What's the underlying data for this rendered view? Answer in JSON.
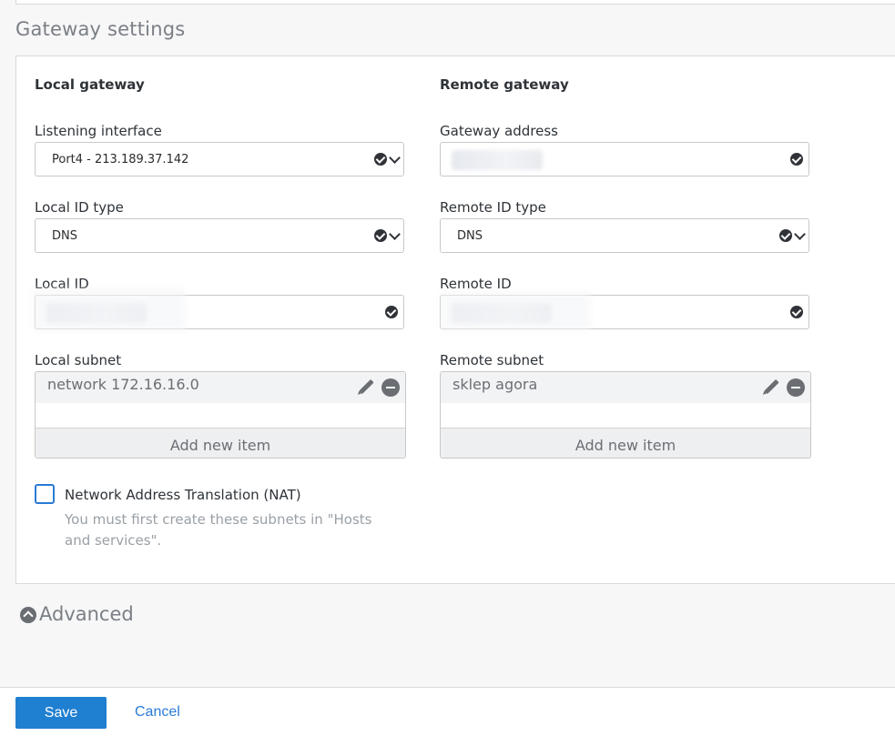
{
  "section": {
    "title": "Gateway settings"
  },
  "local": {
    "heading": "Local gateway",
    "listening_interface": {
      "label": "Listening interface",
      "value": "Port4 - 213.189.37.142"
    },
    "id_type": {
      "label": "Local ID type",
      "value": "DNS"
    },
    "id": {
      "label": "Local ID",
      "value": ""
    },
    "subnet": {
      "label": "Local subnet",
      "items": [
        "network 172.16.16.0"
      ],
      "add_label": "Add new item"
    }
  },
  "remote": {
    "heading": "Remote gateway",
    "gateway_address": {
      "label": "Gateway address",
      "value": ""
    },
    "id_type": {
      "label": "Remote ID type",
      "value": "DNS"
    },
    "id": {
      "label": "Remote ID",
      "value": ""
    },
    "subnet": {
      "label": "Remote subnet",
      "items": [
        "sklep agora"
      ],
      "add_label": "Add new item"
    }
  },
  "nat": {
    "label": "Network Address Translation (NAT)",
    "checked": false,
    "hint": "You must first create these subnets in \"Hosts and services\"."
  },
  "advanced": {
    "label": "Advanced"
  },
  "footer": {
    "save_label": "Save",
    "cancel_label": "Cancel"
  },
  "colors": {
    "accent": "#1f7fd0",
    "link": "#2a7bd6",
    "icon": "#2f3338"
  }
}
